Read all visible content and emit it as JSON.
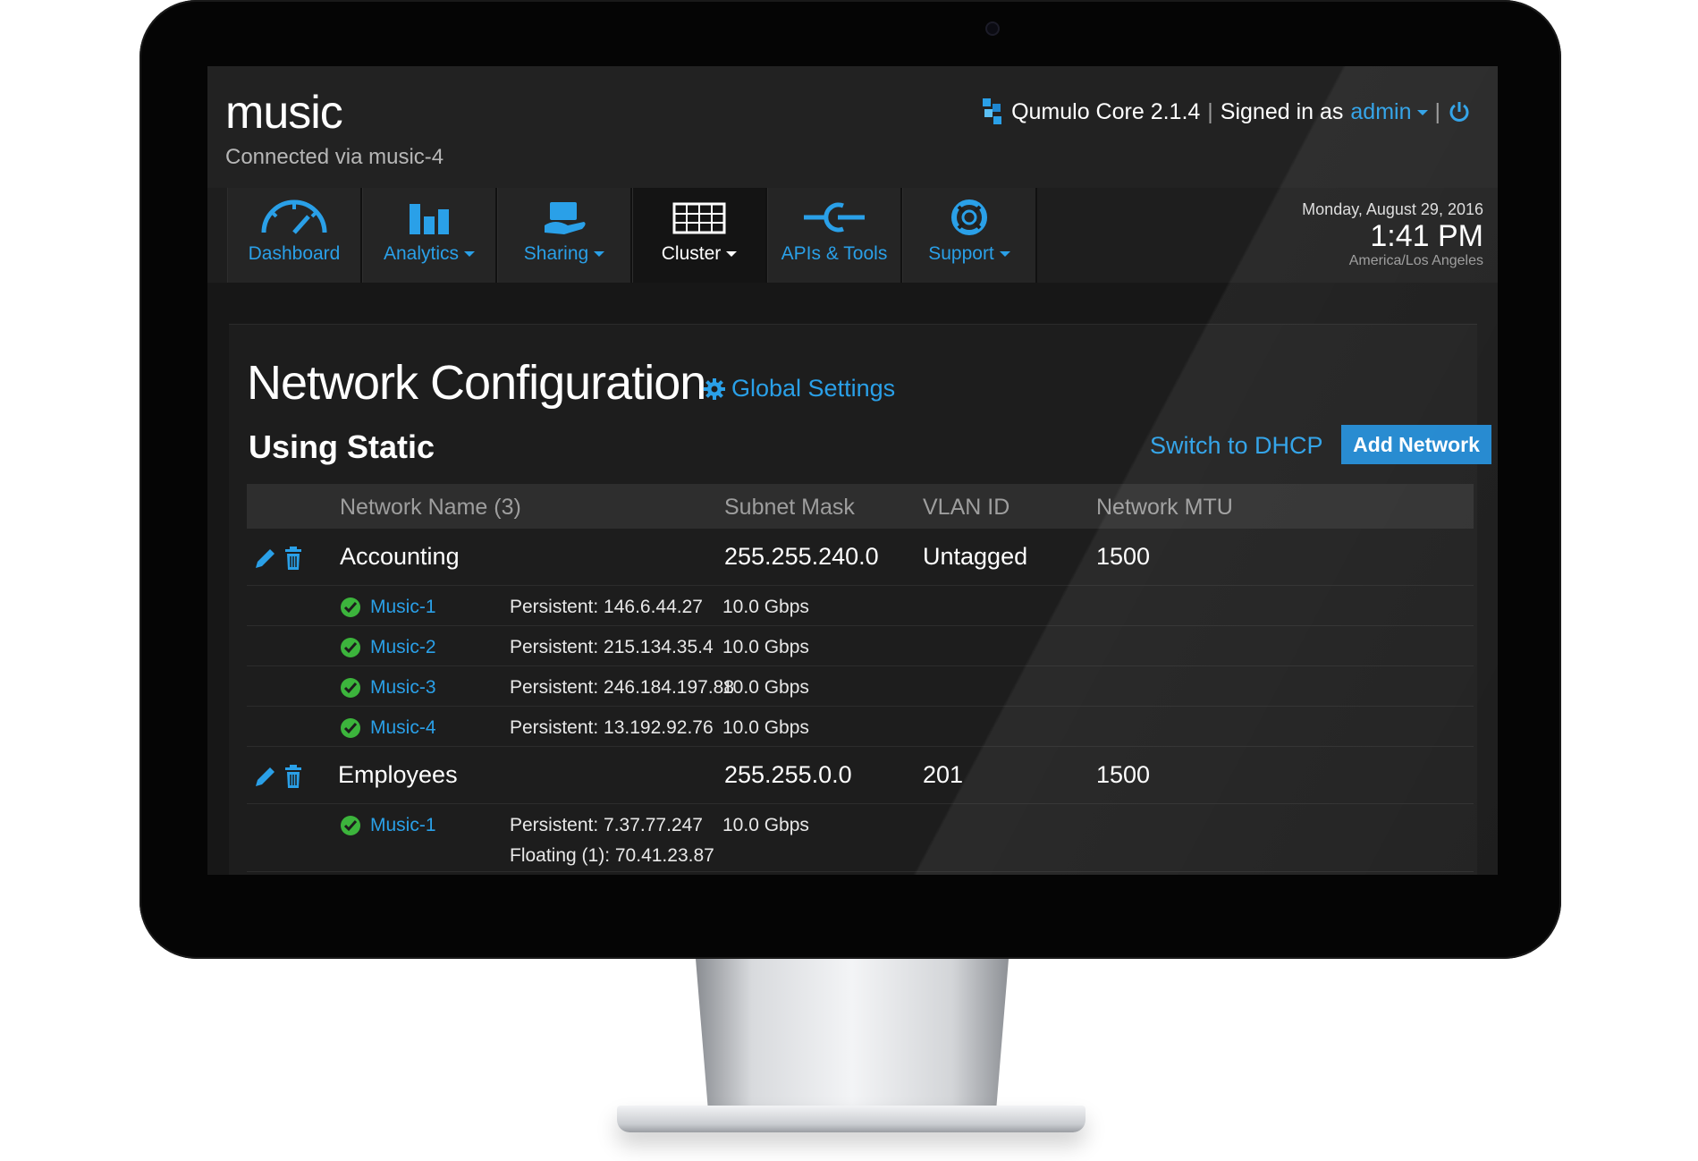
{
  "header": {
    "cluster_name": "music",
    "connected_via": "Connected via music-4",
    "product": "Qumulo Core 2.1.4",
    "signed_in_as": "Signed in as",
    "user": "admin"
  },
  "nav": {
    "tabs": [
      {
        "label": "Dashboard",
        "icon": "speedometer-icon"
      },
      {
        "label": "Analytics",
        "icon": "bar-chart-icon"
      },
      {
        "label": "Sharing",
        "icon": "share-hand-icon"
      },
      {
        "label": "Cluster",
        "icon": "server-rack-icon",
        "active": true
      },
      {
        "label": "APIs & Tools",
        "icon": "plug-icon"
      },
      {
        "label": "Support",
        "icon": "lifebuoy-icon"
      }
    ]
  },
  "clock": {
    "date": "Monday, August 29, 2016",
    "time": "1:41 PM",
    "timezone": "America/Los Angeles"
  },
  "page": {
    "title": "Network Configuration",
    "global_settings": "Global Settings",
    "mode": "Using Static",
    "switch_link": "Switch to DHCP",
    "add_button": "Add Network"
  },
  "table": {
    "columns": [
      "Network Name (3)",
      "Subnet Mask",
      "VLAN ID",
      "Network MTU"
    ],
    "networks": [
      {
        "name": "Accounting",
        "subnet": "255.255.240.0",
        "vlan": "Untagged",
        "mtu": "1500",
        "nodes": [
          {
            "name": "Music-1",
            "ip": "Persistent: 146.6.44.27",
            "speed": "10.0 Gbps"
          },
          {
            "name": "Music-2",
            "ip": "Persistent: 215.134.35.4",
            "speed": "10.0 Gbps"
          },
          {
            "name": "Music-3",
            "ip": "Persistent: 246.184.197.88",
            "speed": "10.0 Gbps"
          },
          {
            "name": "Music-4",
            "ip": "Persistent: 13.192.92.76",
            "speed": "10.0 Gbps"
          }
        ]
      },
      {
        "name": "Employees",
        "subnet": "255.255.0.0",
        "vlan": "201",
        "mtu": "1500",
        "nodes": [
          {
            "name": "Music-1",
            "ip": "Persistent: 7.37.77.247",
            "floating": "Floating (1): 70.41.23.87",
            "speed": "10.0 Gbps"
          }
        ]
      }
    ]
  },
  "colors": {
    "accent": "#2aa0e8",
    "button": "#1e86cf",
    "ok": "#3cb43c",
    "background": "#171717"
  }
}
